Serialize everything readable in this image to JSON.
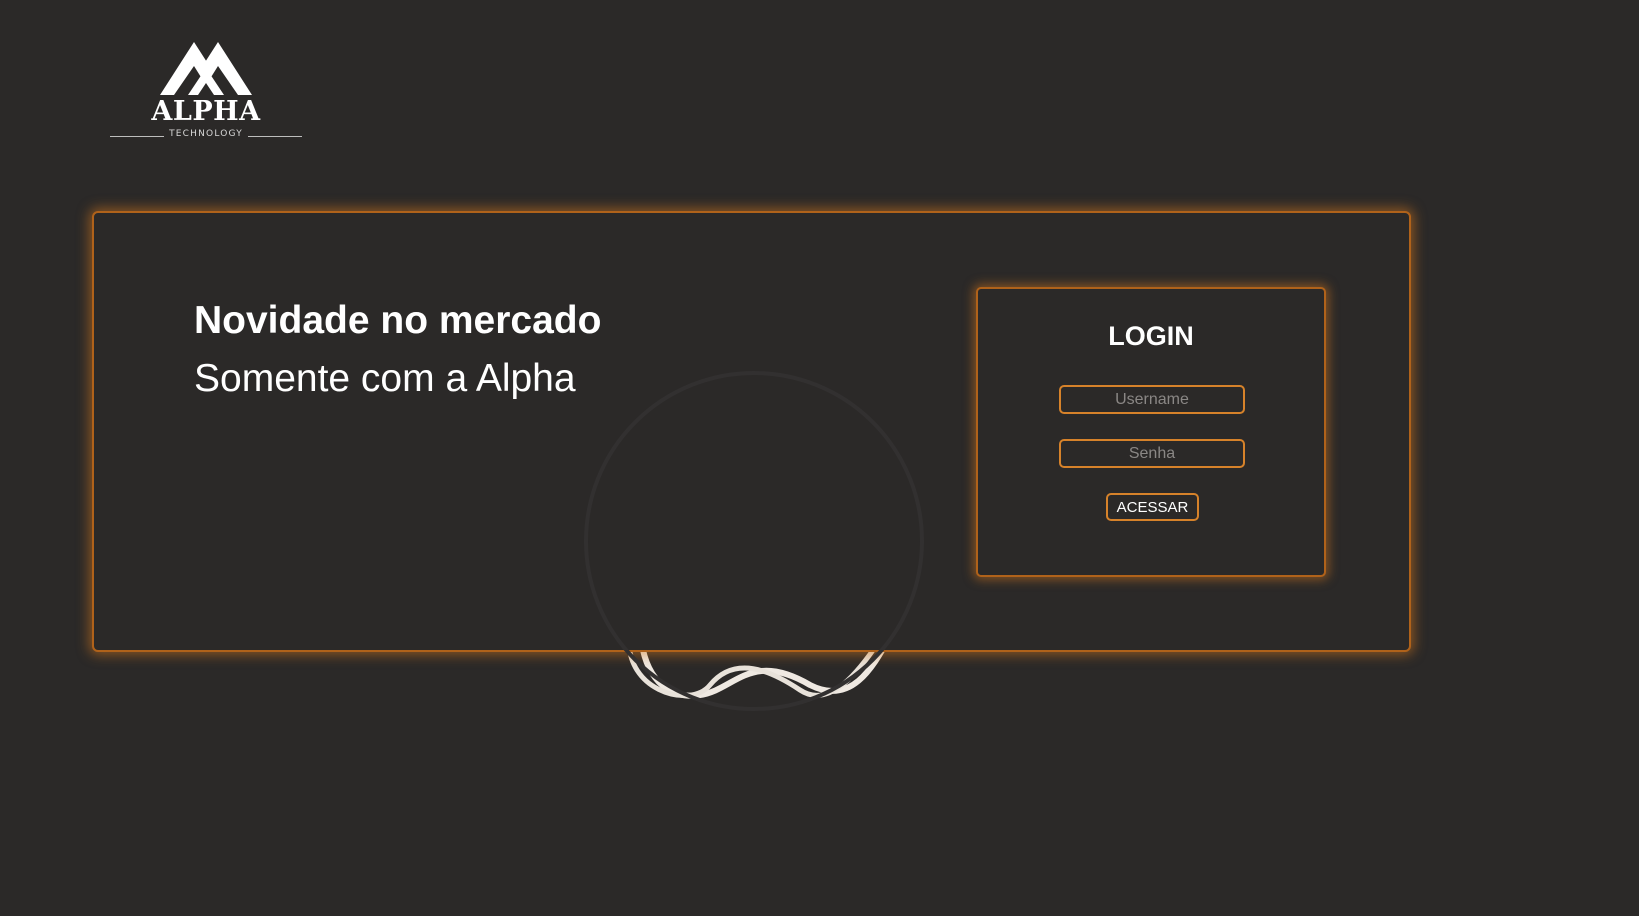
{
  "logo": {
    "name": "ALPHA",
    "tagline": "TECHNOLOGY",
    "icon": "alpha-mountain-logo"
  },
  "hero": {
    "headline": "Novidade no mercado",
    "subheadline": "Somente com a Alpha"
  },
  "login": {
    "title": "LOGIN",
    "username_placeholder": "Username",
    "password_placeholder": "Senha",
    "submit_label": "ACESSAR"
  },
  "colors": {
    "background": "#2b2928",
    "accent": "#d6822a",
    "text": "#ffffff"
  }
}
